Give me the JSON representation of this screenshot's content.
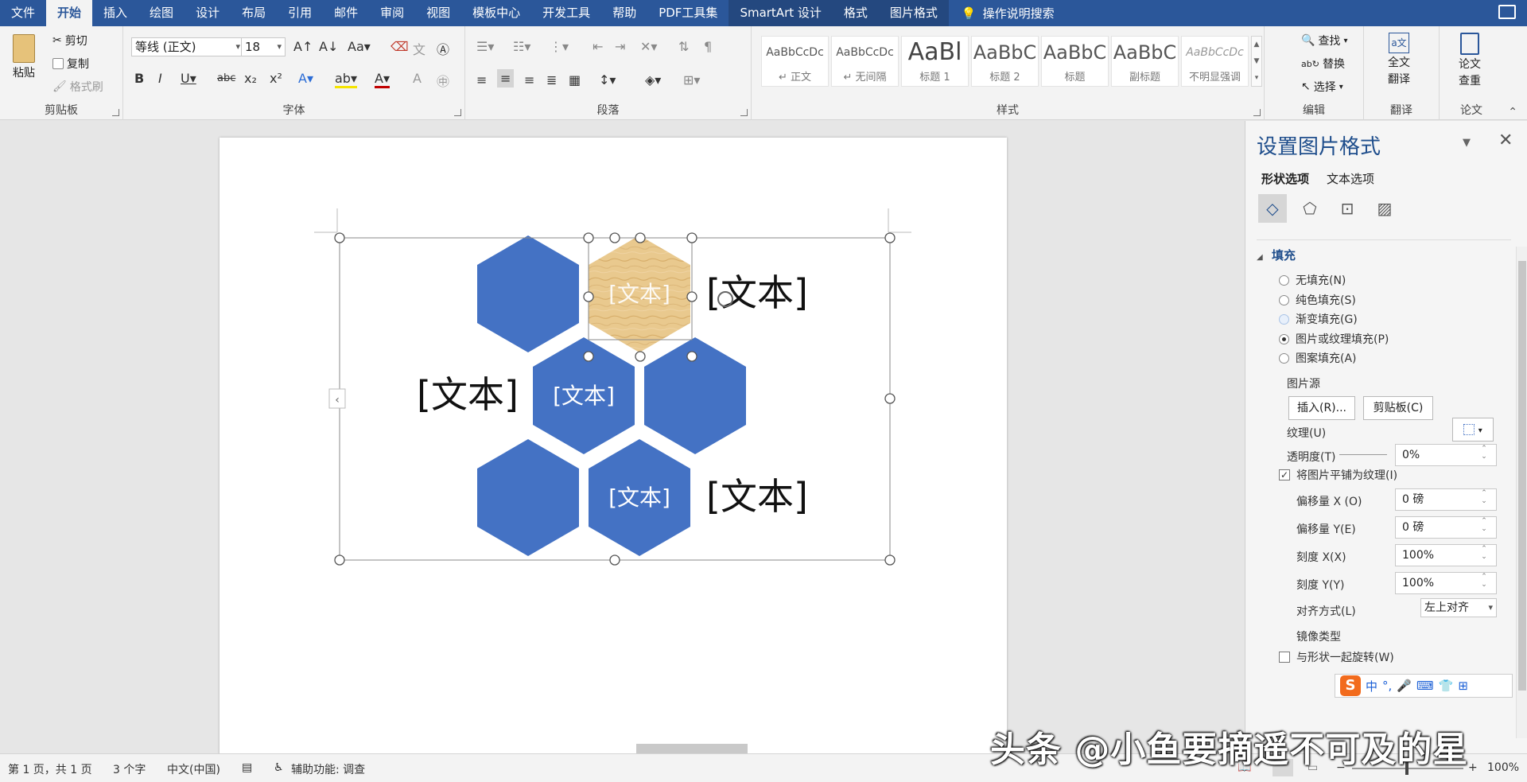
{
  "tabs": [
    {
      "label": "文件",
      "active": false
    },
    {
      "label": "开始",
      "active": true
    },
    {
      "label": "插入",
      "active": false
    },
    {
      "label": "绘图",
      "active": false
    },
    {
      "label": "设计",
      "active": false
    },
    {
      "label": "布局",
      "active": false
    },
    {
      "label": "引用",
      "active": false
    },
    {
      "label": "邮件",
      "active": false
    },
    {
      "label": "审阅",
      "active": false
    },
    {
      "label": "视图",
      "active": false
    },
    {
      "label": "模板中心",
      "active": false
    },
    {
      "label": "开发工具",
      "active": false
    },
    {
      "label": "帮助",
      "active": false
    },
    {
      "label": "PDF工具集",
      "active": false
    },
    {
      "label": "SmartArt 设计",
      "active": false,
      "contextual": true
    },
    {
      "label": "格式",
      "active": false,
      "contextual": true
    },
    {
      "label": "图片格式",
      "active": false,
      "contextual": true
    }
  ],
  "search_label": "操作说明搜索",
  "ribbon": {
    "clipboard": {
      "paste": "粘贴",
      "cut": "剪切",
      "copy": "复制",
      "format_painter": "格式刷",
      "label": "剪贴板"
    },
    "font": {
      "font_name": "等线 (正文)",
      "font_size": "18",
      "label": "字体"
    },
    "paragraph": {
      "label": "段落"
    },
    "styles": {
      "label": "样式",
      "items": [
        {
          "sample": "AaBbCcDc",
          "name": "↵ 正文"
        },
        {
          "sample": "AaBbCcDc",
          "name": "↵ 无间隔"
        },
        {
          "sample": "AaBl",
          "name": "标题 1"
        },
        {
          "sample": "AaBbC",
          "name": "标题 2"
        },
        {
          "sample": "AaBbC",
          "name": "标题"
        },
        {
          "sample": "AaBbC",
          "name": "副标题"
        },
        {
          "sample": "AaBbCcDc",
          "name": "不明显强调"
        }
      ]
    },
    "editing": {
      "find": "查找",
      "replace": "替换",
      "select": "选择",
      "label": "编辑"
    },
    "translate": {
      "full_line1": "全文",
      "full_line2": "翻译",
      "label": "翻译"
    },
    "paper": {
      "line1": "论文",
      "line2": "查重",
      "label": "论文"
    }
  },
  "smartart": {
    "hex_color": "#4472c4",
    "text_color": "#ffffff",
    "selected_hex_text": "[文本]",
    "hex_texts": [
      "[文本]",
      "[文本]"
    ],
    "side_labels": [
      "[文本]",
      "[文本]",
      "[文本]"
    ]
  },
  "pane": {
    "title": "设置图片格式",
    "tab_shape": "形状选项",
    "tab_text": "文本选项",
    "section": "填充",
    "fill_options": [
      {
        "label": "无填充(N)",
        "state": "off"
      },
      {
        "label": "纯色填充(S)",
        "state": "off"
      },
      {
        "label": "渐变填充(G)",
        "state": "highlight"
      },
      {
        "label": "图片或纹理填充(P)",
        "state": "on"
      },
      {
        "label": "图案填充(A)",
        "state": "off"
      }
    ],
    "picture_source": "图片源",
    "insert_btn": "插入(R)...",
    "clipboard_btn": "剪贴板(C)",
    "texture_label": "纹理(U)",
    "transparency_label": "透明度(T)",
    "transparency_value": "0%",
    "tile_label": "将图片平铺为纹理(I)",
    "tile_checked": true,
    "offset_x_label": "偏移量 X (O)",
    "offset_x_value": "0 磅",
    "offset_y_label": "偏移量 Y(E)",
    "offset_y_value": "0 磅",
    "scale_x_label": "刻度 X(X)",
    "scale_x_value": "100%",
    "scale_y_label": "刻度 Y(Y)",
    "scale_y_value": "100%",
    "align_label": "对齐方式(L)",
    "align_value": "左上对齐",
    "mirror_label": "镜像类型",
    "rotate_label": "与形状一起旋转(W)"
  },
  "ime": {
    "logo": "S",
    "items": [
      "中",
      "°,",
      "🎤",
      "⌨",
      "👕",
      "⊞"
    ]
  },
  "status": {
    "page": "第 1 页，共 1 页",
    "words": "3 个字",
    "language": "中文(中国)",
    "accessibility": "辅助功能: 调查",
    "zoom": "100%"
  },
  "watermark": "头条 @小鱼要摘遥不可及的星"
}
